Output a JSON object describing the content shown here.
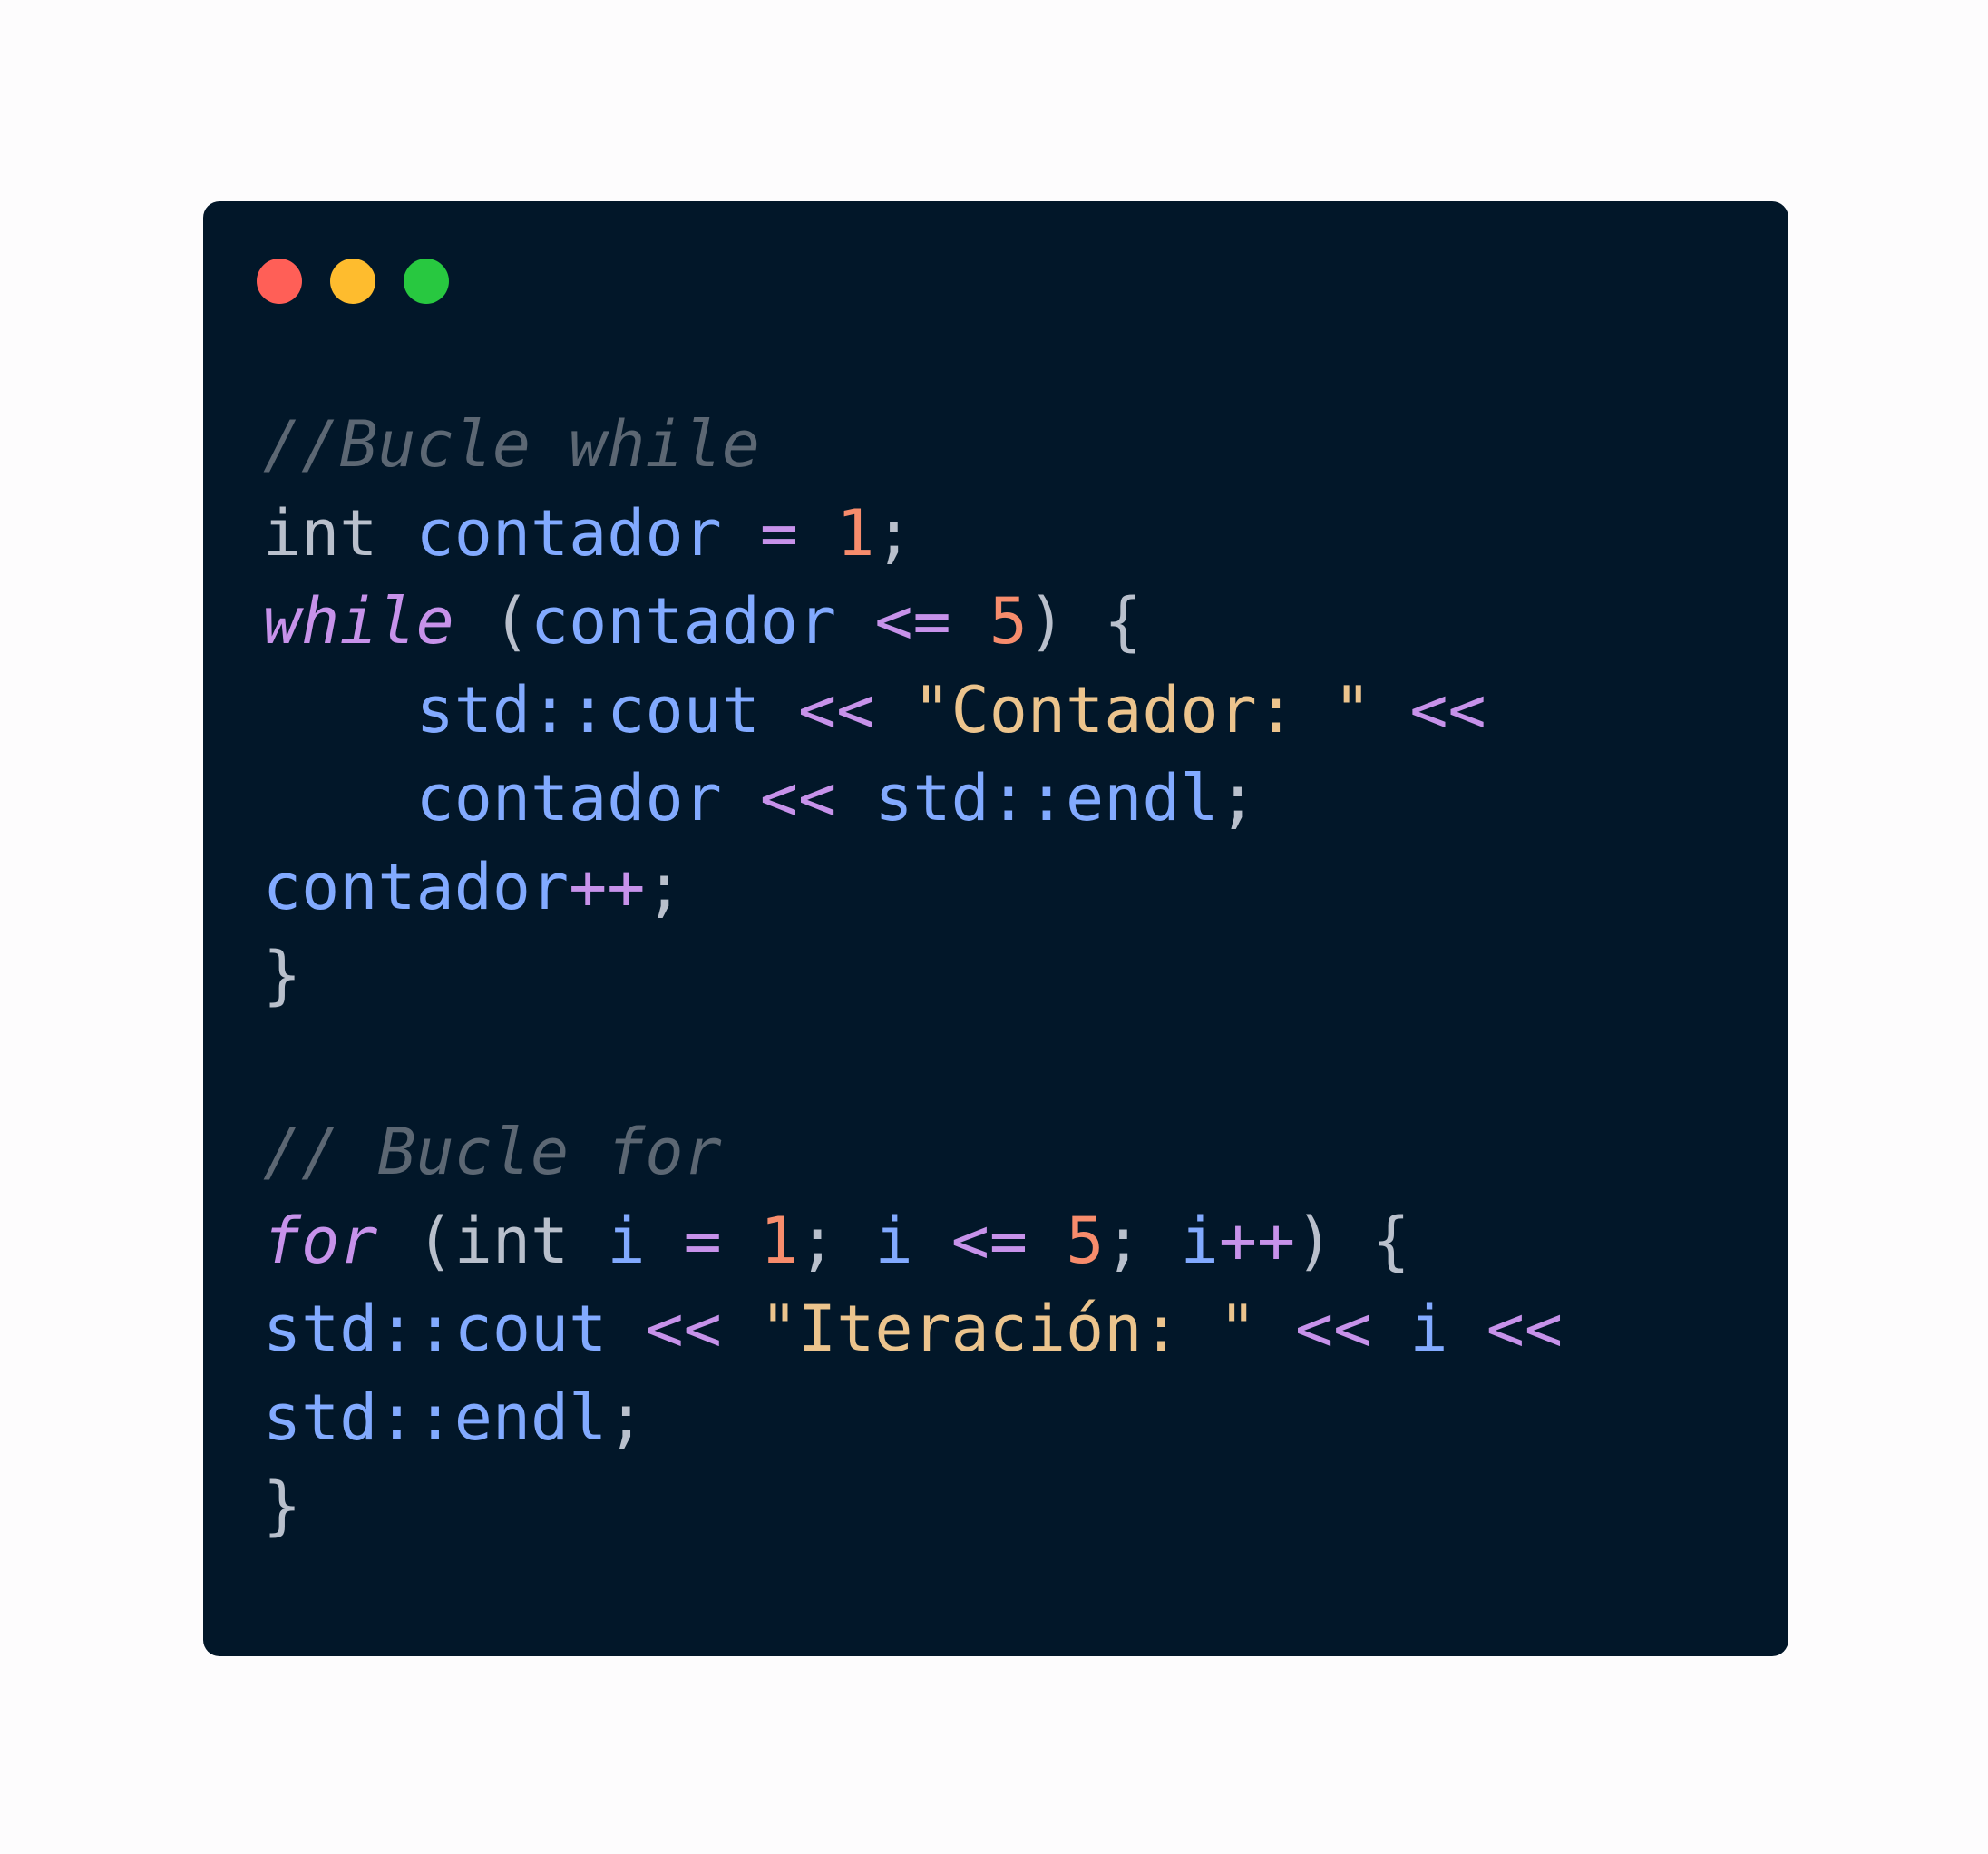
{
  "window": {
    "controls": [
      {
        "name": "close-button",
        "color": "#ff5f57"
      },
      {
        "name": "minimize-button",
        "color": "#febc2e"
      },
      {
        "name": "maximize-button",
        "color": "#28c840"
      }
    ]
  },
  "code": {
    "language": "cpp",
    "lines": [
      [
        {
          "t": "comment",
          "v": "//Bucle while"
        }
      ],
      [
        {
          "t": "type",
          "v": "int"
        },
        {
          "t": "ws",
          "v": " "
        },
        {
          "t": "ident",
          "v": "contador"
        },
        {
          "t": "ws",
          "v": " "
        },
        {
          "t": "op",
          "v": "="
        },
        {
          "t": "ws",
          "v": " "
        },
        {
          "t": "num",
          "v": "1"
        },
        {
          "t": "punct",
          "v": ";"
        }
      ],
      [
        {
          "t": "keyword",
          "v": "while"
        },
        {
          "t": "ws",
          "v": " "
        },
        {
          "t": "punct",
          "v": "("
        },
        {
          "t": "ident",
          "v": "contador"
        },
        {
          "t": "ws",
          "v": " "
        },
        {
          "t": "op",
          "v": "<="
        },
        {
          "t": "ws",
          "v": " "
        },
        {
          "t": "num",
          "v": "5"
        },
        {
          "t": "punct",
          "v": ")"
        },
        {
          "t": "ws",
          "v": " "
        },
        {
          "t": "punct",
          "v": "{"
        }
      ],
      [
        {
          "t": "ws",
          "v": "    "
        },
        {
          "t": "ident",
          "v": "std::cout"
        },
        {
          "t": "ws",
          "v": " "
        },
        {
          "t": "op",
          "v": "<<"
        },
        {
          "t": "ws",
          "v": " "
        },
        {
          "t": "str",
          "v": "\"Contador: \""
        },
        {
          "t": "ws",
          "v": " "
        },
        {
          "t": "op",
          "v": "<<"
        }
      ],
      [
        {
          "t": "ws",
          "v": "    "
        },
        {
          "t": "ident",
          "v": "contador"
        },
        {
          "t": "ws",
          "v": " "
        },
        {
          "t": "op",
          "v": "<<"
        },
        {
          "t": "ws",
          "v": " "
        },
        {
          "t": "ident",
          "v": "std::endl"
        },
        {
          "t": "punct",
          "v": ";"
        }
      ],
      [
        {
          "t": "ident",
          "v": "contador"
        },
        {
          "t": "op",
          "v": "++"
        },
        {
          "t": "punct",
          "v": ";"
        }
      ],
      [
        {
          "t": "punct",
          "v": "}"
        }
      ],
      [],
      [
        {
          "t": "comment",
          "v": "// Bucle for"
        }
      ],
      [
        {
          "t": "keyword",
          "v": "for"
        },
        {
          "t": "ws",
          "v": " "
        },
        {
          "t": "punct",
          "v": "("
        },
        {
          "t": "type",
          "v": "int"
        },
        {
          "t": "ws",
          "v": " "
        },
        {
          "t": "ident",
          "v": "i"
        },
        {
          "t": "ws",
          "v": " "
        },
        {
          "t": "op",
          "v": "="
        },
        {
          "t": "ws",
          "v": " "
        },
        {
          "t": "num",
          "v": "1"
        },
        {
          "t": "punct",
          "v": ";"
        },
        {
          "t": "ws",
          "v": " "
        },
        {
          "t": "ident",
          "v": "i"
        },
        {
          "t": "ws",
          "v": " "
        },
        {
          "t": "op",
          "v": "<="
        },
        {
          "t": "ws",
          "v": " "
        },
        {
          "t": "num",
          "v": "5"
        },
        {
          "t": "punct",
          "v": ";"
        },
        {
          "t": "ws",
          "v": " "
        },
        {
          "t": "ident",
          "v": "i"
        },
        {
          "t": "op",
          "v": "++"
        },
        {
          "t": "punct",
          "v": ")"
        },
        {
          "t": "ws",
          "v": " "
        },
        {
          "t": "punct",
          "v": "{"
        }
      ],
      [
        {
          "t": "ident",
          "v": "std::cout"
        },
        {
          "t": "ws",
          "v": " "
        },
        {
          "t": "op",
          "v": "<<"
        },
        {
          "t": "ws",
          "v": " "
        },
        {
          "t": "str",
          "v": "\"Iteración: \""
        },
        {
          "t": "ws",
          "v": " "
        },
        {
          "t": "op",
          "v": "<<"
        },
        {
          "t": "ws",
          "v": " "
        },
        {
          "t": "ident",
          "v": "i"
        },
        {
          "t": "ws",
          "v": " "
        },
        {
          "t": "op",
          "v": "<<"
        }
      ],
      [
        {
          "t": "ident",
          "v": "std::endl"
        },
        {
          "t": "punct",
          "v": ";"
        }
      ],
      [
        {
          "t": "punct",
          "v": "}"
        }
      ]
    ]
  },
  "colors": {
    "background": "#fdfcfd",
    "window": "#021729",
    "comment": "#5c6773",
    "keyword": "#c792ea",
    "identifier": "#82aaff",
    "number": "#f78c6c",
    "string": "#ecc48d",
    "plain": "#b9c0cc"
  }
}
